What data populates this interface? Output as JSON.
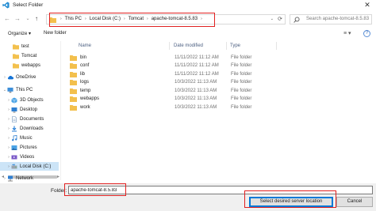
{
  "window": {
    "title": "Select Folder",
    "close_glyph": "✕"
  },
  "navbar": {
    "back_glyph": "←",
    "forward_glyph": "→",
    "down_glyph": "⌄",
    "up_glyph": "↑",
    "breadcrumbs": [
      "This PC",
      "Local Disk (C:)",
      "Tomcat",
      "apache-tomcat-8.5.83"
    ],
    "crumb_separator": "›",
    "dropdown_glyph": "⌄",
    "refresh_glyph": "⟳",
    "search_placeholder": "Search apache-tomcat-8.5.83"
  },
  "toolbar": {
    "organize_label": "Organize ▾",
    "new_folder_label": "New folder",
    "view_glyph": "≡ ▾",
    "help_glyph": "?"
  },
  "sidebar": {
    "items": [
      {
        "label": "test",
        "icon": "folder-icon",
        "chevron": ""
      },
      {
        "label": "Tomcat",
        "icon": "folder-icon",
        "chevron": ""
      },
      {
        "label": "webapps",
        "icon": "folder-icon",
        "chevron": ""
      },
      {
        "label": "OneDrive",
        "icon": "cloud-icon",
        "chevron": "›"
      },
      {
        "label": "This PC",
        "icon": "computer-icon",
        "chevron": "⌄"
      },
      {
        "label": "3D Objects",
        "icon": "cube-icon",
        "chevron": "›"
      },
      {
        "label": "Desktop",
        "icon": "desktop-icon",
        "chevron": "›"
      },
      {
        "label": "Documents",
        "icon": "documents-icon",
        "chevron": "›"
      },
      {
        "label": "Downloads",
        "icon": "downloads-icon",
        "chevron": "›"
      },
      {
        "label": "Music",
        "icon": "music-icon",
        "chevron": "›"
      },
      {
        "label": "Pictures",
        "icon": "pictures-icon",
        "chevron": "›"
      },
      {
        "label": "Videos",
        "icon": "videos-icon",
        "chevron": "›"
      },
      {
        "label": "Local Disk (C:)",
        "icon": "drive-icon",
        "chevron": "›"
      }
    ],
    "network_label": "Network",
    "selected_index": 12
  },
  "table": {
    "columns": [
      "Name",
      "Date modified",
      "Type"
    ],
    "rows": [
      {
        "name": "bin",
        "date": "11/11/2022 11:12 AM",
        "type": "File folder"
      },
      {
        "name": "conf",
        "date": "11/11/2022 11:12 AM",
        "type": "File folder"
      },
      {
        "name": "lib",
        "date": "11/11/2022 11:12 AM",
        "type": "File folder"
      },
      {
        "name": "logs",
        "date": "10/3/2022 11:13 AM",
        "type": "File folder"
      },
      {
        "name": "temp",
        "date": "10/3/2022 11:13 AM",
        "type": "File folder"
      },
      {
        "name": "webapps",
        "date": "10/3/2022 11:13 AM",
        "type": "File folder"
      },
      {
        "name": "work",
        "date": "10/3/2022 11:13 AM",
        "type": "File folder"
      }
    ]
  },
  "footer": {
    "folder_label": "Folder:",
    "folder_value": "apache-tomcat-8.5.83",
    "select_button": "Select desired server location",
    "cancel_button": "Cancel"
  },
  "colors": {
    "highlight": "#e02020",
    "selection": "#cce4f7",
    "folder": "#f3c04d",
    "accent": "#0078d7"
  }
}
